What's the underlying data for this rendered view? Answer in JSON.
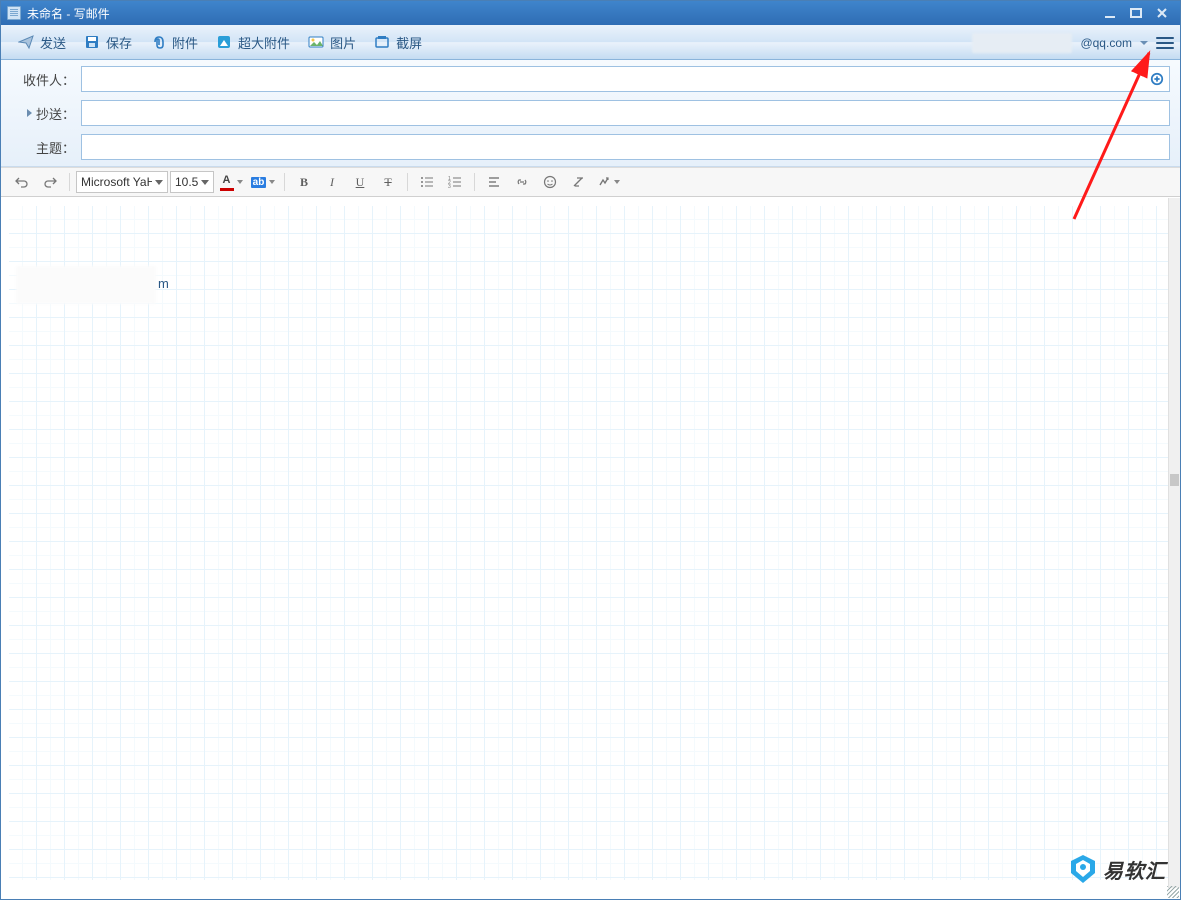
{
  "window": {
    "title": "未命名 - 写邮件"
  },
  "toolbar": {
    "send": "发送",
    "save": "保存",
    "attach": "附件",
    "bigattach": "超大附件",
    "image": "图片",
    "screenshot": "截屏"
  },
  "account": {
    "domain": "@qq.com"
  },
  "fields": {
    "to_label": "收件人：",
    "cc_label": "抄送：",
    "subject_label": "主题："
  },
  "format": {
    "font": "Microsoft YaHei",
    "size": "10.5"
  },
  "body": {
    "sig_tail": "m"
  },
  "watermark": {
    "text": "易软汇"
  }
}
